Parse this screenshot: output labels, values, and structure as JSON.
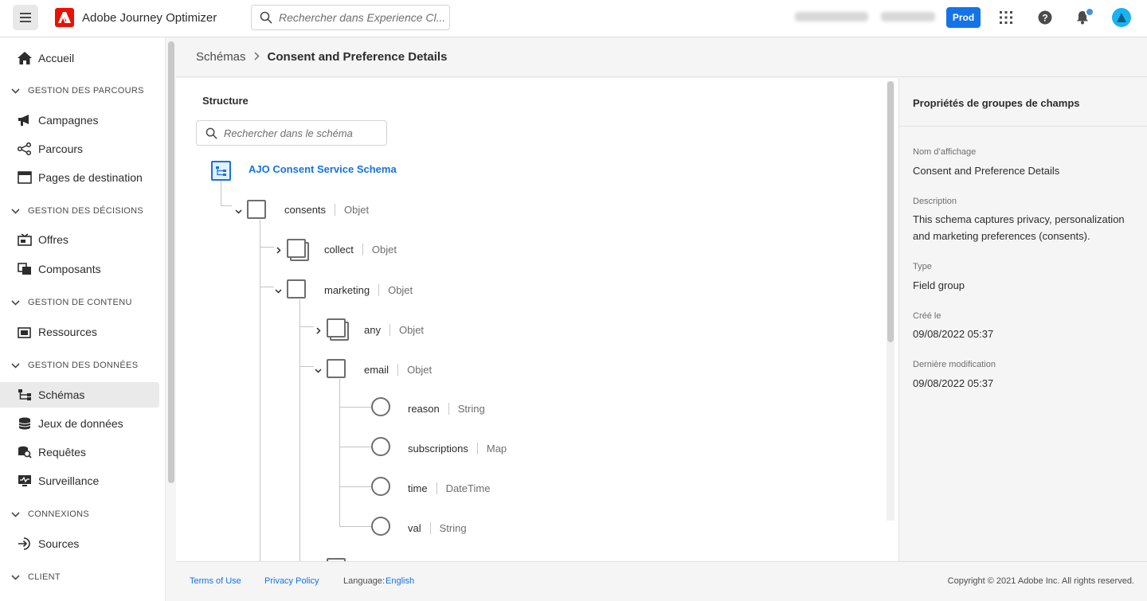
{
  "app": {
    "title": "Adobe Journey Optimizer",
    "search_placeholder": "Rechercher dans Experience Cl...",
    "env_button": "Prod",
    "accent": "#1473e6",
    "brand_red": "#eb1000"
  },
  "sidebar": {
    "home": "Accueil",
    "sections": {
      "parcours": "GESTION DES PARCOURS",
      "decisions": "GESTION DES DÉCISIONS",
      "contenu": "GESTION DE CONTENU",
      "donnees": "GESTION DES DONNÉES",
      "connexions": "CONNEXIONS",
      "client": "CLIENT"
    },
    "items": {
      "campagnes": "Campagnes",
      "parcours": "Parcours",
      "pages": "Pages de destination",
      "offres": "Offres",
      "composants": "Composants",
      "ressources": "Ressources",
      "schemas": "Schémas",
      "jeux": "Jeux de données",
      "requetes": "Requêtes",
      "surveillance": "Surveillance",
      "sources": "Sources"
    }
  },
  "breadcrumb": {
    "parent": "Schémas",
    "current": "Consent and Preference Details"
  },
  "structure": {
    "title": "Structure",
    "search_placeholder": "Rechercher dans le schéma",
    "root": "AJO Consent Service Schema",
    "nodes": {
      "consents": {
        "name": "consents",
        "type": "Objet"
      },
      "collect": {
        "name": "collect",
        "type": "Objet"
      },
      "marketing": {
        "name": "marketing",
        "type": "Objet"
      },
      "any": {
        "name": "any",
        "type": "Objet"
      },
      "email": {
        "name": "email",
        "type": "Objet"
      },
      "reason": {
        "name": "reason",
        "type": "String"
      },
      "subscriptions": {
        "name": "subscriptions",
        "type": "Map"
      },
      "time": {
        "name": "time",
        "type": "DateTime"
      },
      "val": {
        "name": "val",
        "type": "String"
      }
    }
  },
  "properties": {
    "title": "Propriétés de groupes de champs",
    "display_name_label": "Nom d’affichage",
    "display_name": "Consent and Preference Details",
    "description_label": "Description",
    "description": "This schema captures privacy, personalization and marketing preferences (consents).",
    "type_label": "Type",
    "type": "Field group",
    "created_label": "Créé le",
    "created": "09/08/2022 05:37",
    "modified_label": "Dernière modification",
    "modified": "09/08/2022 05:37"
  },
  "footer": {
    "terms": "Terms of Use",
    "privacy": "Privacy Policy",
    "language_label": "Language:",
    "language": "English",
    "copyright": "Copyright ©  2021 Adobe Inc.  All rights reserved."
  }
}
